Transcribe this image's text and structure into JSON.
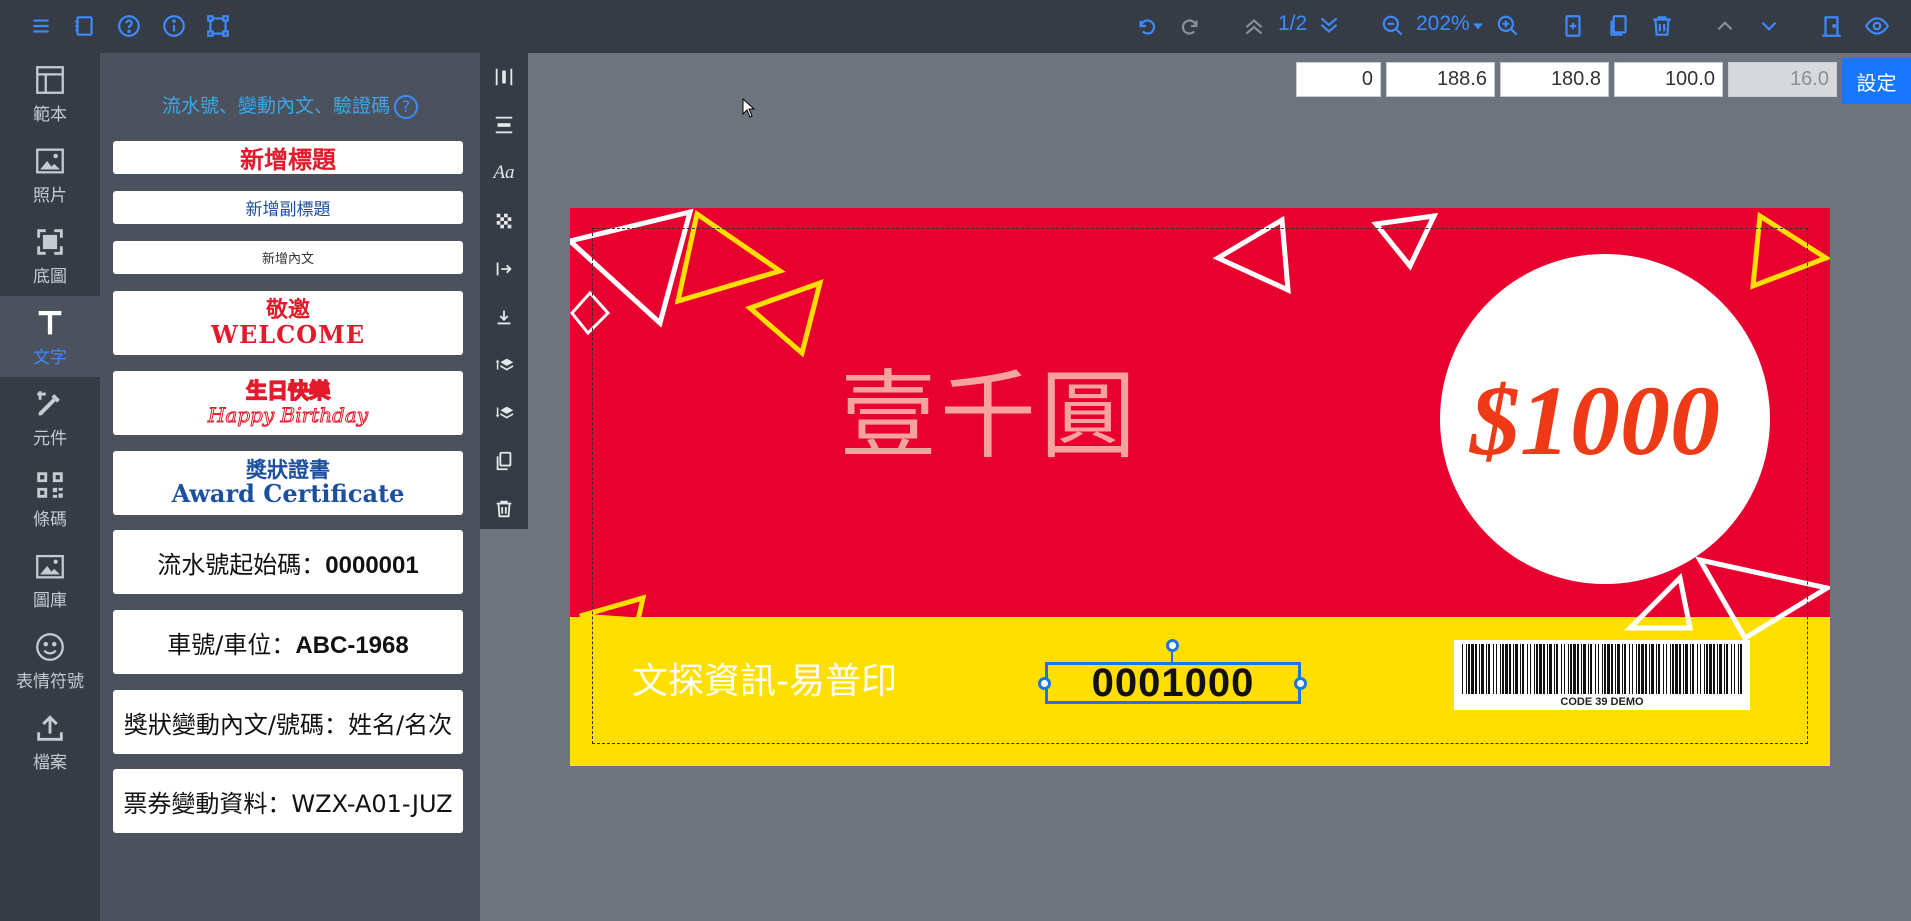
{
  "topbar": {
    "page_indicator": "1/2",
    "zoom": "202%",
    "icons_left": [
      "menu-icon",
      "notebook-icon",
      "help-icon",
      "info-icon",
      "select-frame-icon"
    ],
    "icons_right": [
      "undo-icon",
      "redo-icon",
      "page-up-icon",
      "page-down-icon",
      "zoom-out-icon",
      "zoom-in-icon",
      "add-page-icon",
      "copy-page-icon",
      "delete-page-icon",
      "move-up-icon",
      "move-down-icon",
      "exit-icon",
      "preview-icon"
    ]
  },
  "leftnav": {
    "items": [
      {
        "label": "範本",
        "icon": "template-icon"
      },
      {
        "label": "照片",
        "icon": "photo-icon"
      },
      {
        "label": "底圖",
        "icon": "background-icon"
      },
      {
        "label": "文字",
        "icon": "text-icon",
        "active": true
      },
      {
        "label": "元件",
        "icon": "element-icon"
      },
      {
        "label": "條碼",
        "icon": "barcode-icon"
      },
      {
        "label": "圖庫",
        "icon": "gallery-icon"
      },
      {
        "label": "表情符號",
        "icon": "emoji-icon"
      },
      {
        "label": "檔案",
        "icon": "file-upload-icon"
      }
    ]
  },
  "panel": {
    "title": "流水號、變動內文、驗證碼",
    "help": "?",
    "add_title": "新增標題",
    "add_subtitle": "新增副標題",
    "add_body": "新增內文",
    "welcome_top": "敬邀",
    "welcome_bottom": "WELCOME",
    "bday_top": "生日快樂",
    "bday_bottom": "Happy Birthday",
    "award_top": "獎狀證書",
    "award_bottom": "Award Certificate",
    "serial_label": "流水號起始碼：",
    "serial_value": "0000001",
    "plate_label": "車號/車位：",
    "plate_value": "ABC-1968",
    "award_var": "獎狀變動內文/號碼：姓名/名次",
    "ticket_var": "票券變動資料：WZX-A01-JUZ"
  },
  "vtoolbar": {
    "font_button": "Aa",
    "icons": [
      "align-vertical-icon",
      "align-horizontal-icon",
      "font-icon",
      "transparency-icon",
      "align-right-edge-icon",
      "align-bottom-edge-icon",
      "bring-forward-icon",
      "send-backward-icon",
      "duplicate-icon",
      "delete-icon"
    ]
  },
  "properties": {
    "x": "0",
    "y": "188.6",
    "width": "180.8",
    "height": "100.0",
    "font_size": "16.0",
    "apply_label": "設定"
  },
  "ticket": {
    "big_text": "壹千圓",
    "amount": "$1000",
    "company": "文探資訊-易普印",
    "serial": "0001000",
    "barcode_label": "CODE 39 DEMO",
    "colors": {
      "red": "#e8002f",
      "yellow": "#ffdf00",
      "amount": "#ef3a17",
      "selection": "#1d74e8"
    }
  }
}
